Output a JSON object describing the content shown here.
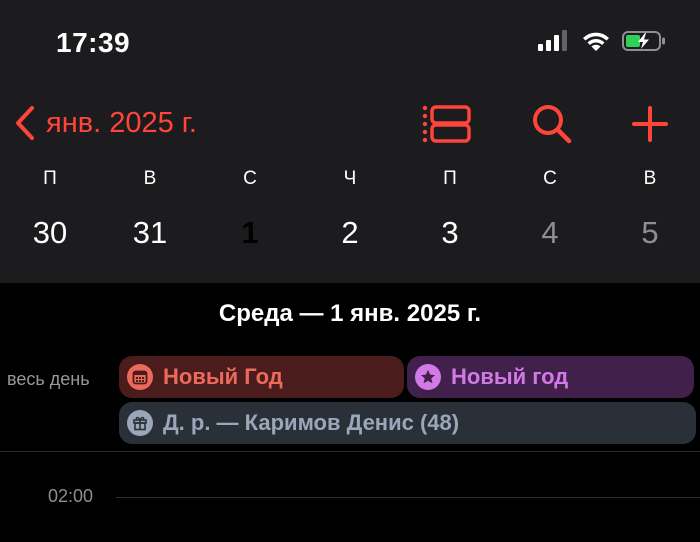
{
  "status_bar": {
    "time": "17:39"
  },
  "nav": {
    "back_label": "янв. 2025 г."
  },
  "week": {
    "weekdays": [
      "П",
      "В",
      "С",
      "Ч",
      "П",
      "С",
      "В"
    ],
    "days": [
      "30",
      "31",
      "1",
      "2",
      "3",
      "4",
      "5"
    ],
    "selected_index": 2
  },
  "day_title": "Среда — 1 янв. 2025 г.",
  "all_day": {
    "label": "весь день",
    "events": [
      {
        "title": "Новый Год",
        "icon": "calendar-icon",
        "color": "#ec6a5c"
      },
      {
        "title": "Новый год",
        "icon": "star-icon",
        "color": "#d17ae6"
      },
      {
        "title": "Д. р. — Каримов Денис (48)",
        "icon": "gift-icon",
        "color": "#9aa7b8"
      }
    ]
  },
  "timeline": {
    "hour_label": "02:00"
  },
  "colors": {
    "accent": "#ff453a",
    "background": "#000000",
    "header_bg": "#1c1c1e"
  }
}
